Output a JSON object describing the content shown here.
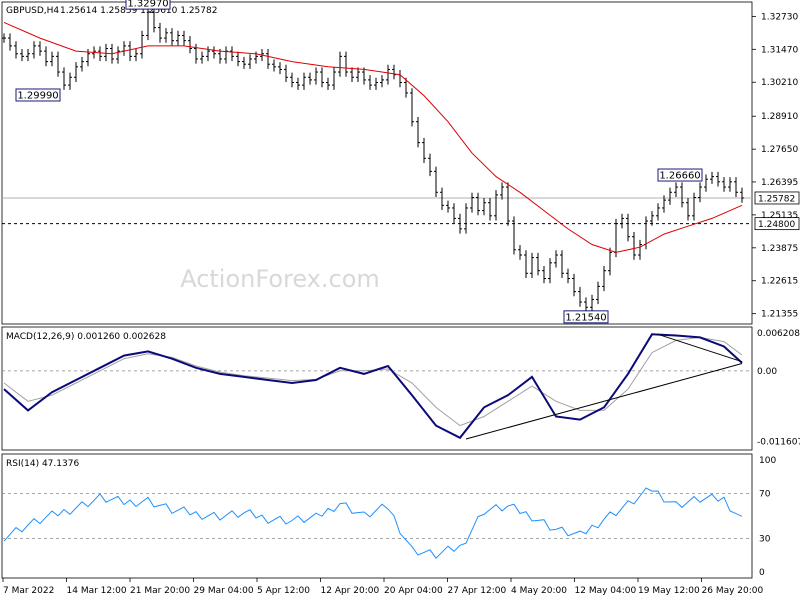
{
  "chart_data": [
    {
      "type": "candlestick",
      "title": "GBPUSD,H4",
      "ohlc_text": "1.25614 1.25859 1.25610 1.25782",
      "watermark": "ActionForex.com",
      "ylim": [
        1.2096,
        1.3328
      ],
      "y_ticks": [
        "1.32730",
        "1.31470",
        "1.30210",
        "1.28910",
        "1.27650",
        "1.26395",
        "1.25135",
        "1.23875",
        "1.22615",
        "1.21355"
      ],
      "current_price": "1.25782",
      "horizontal_level": "1.24800",
      "annotations": [
        {
          "label": "1.32970",
          "x": 24,
          "price": 1.3297
        },
        {
          "label": "1.29990",
          "x": 10,
          "price": 1.2999
        },
        {
          "label": "1.21540",
          "x": 97,
          "price": 1.2154
        },
        {
          "label": "1.26660",
          "x": 117,
          "price": 1.2666
        }
      ],
      "price_points": [
        [
          0,
          1.319
        ],
        [
          1,
          1.316
        ],
        [
          2,
          1.313
        ],
        [
          3,
          1.312
        ],
        [
          4,
          1.313
        ],
        [
          5,
          1.316
        ],
        [
          6,
          1.314
        ],
        [
          7,
          1.31
        ],
        [
          8,
          1.312
        ],
        [
          9,
          1.306
        ],
        [
          10,
          1.301
        ],
        [
          11,
          1.304
        ],
        [
          12,
          1.308
        ],
        [
          13,
          1.31
        ],
        [
          14,
          1.313
        ],
        [
          15,
          1.314
        ],
        [
          16,
          1.312
        ],
        [
          17,
          1.315
        ],
        [
          18,
          1.311
        ],
        [
          19,
          1.314
        ],
        [
          20,
          1.316
        ],
        [
          21,
          1.312
        ],
        [
          22,
          1.313
        ],
        [
          23,
          1.32
        ],
        [
          24,
          1.329
        ],
        [
          25,
          1.323
        ],
        [
          26,
          1.319
        ],
        [
          27,
          1.321
        ],
        [
          28,
          1.318
        ],
        [
          29,
          1.32
        ],
        [
          30,
          1.318
        ],
        [
          31,
          1.315
        ],
        [
          32,
          1.311
        ],
        [
          33,
          1.312
        ],
        [
          34,
          1.314
        ],
        [
          35,
          1.313
        ],
        [
          36,
          1.311
        ],
        [
          37,
          1.314
        ],
        [
          38,
          1.312
        ],
        [
          39,
          1.31
        ],
        [
          40,
          1.309
        ],
        [
          41,
          1.311
        ],
        [
          42,
          1.312
        ],
        [
          43,
          1.313
        ],
        [
          44,
          1.309
        ],
        [
          45,
          1.308
        ],
        [
          46,
          1.307
        ],
        [
          47,
          1.304
        ],
        [
          48,
          1.302
        ],
        [
          49,
          1.301
        ],
        [
          50,
          1.304
        ],
        [
          51,
          1.303
        ],
        [
          52,
          1.306
        ],
        [
          53,
          1.302
        ],
        [
          54,
          1.301
        ],
        [
          55,
          1.306
        ],
        [
          56,
          1.312
        ],
        [
          57,
          1.306
        ],
        [
          58,
          1.304
        ],
        [
          59,
          1.306
        ],
        [
          60,
          1.303
        ],
        [
          61,
          1.301
        ],
        [
          62,
          1.302
        ],
        [
          63,
          1.303
        ],
        [
          64,
          1.307
        ],
        [
          65,
          1.305
        ],
        [
          66,
          1.302
        ],
        [
          67,
          1.298
        ],
        [
          68,
          1.287
        ],
        [
          69,
          1.279
        ],
        [
          70,
          1.273
        ],
        [
          71,
          1.268
        ],
        [
          72,
          1.26
        ],
        [
          73,
          1.255
        ],
        [
          74,
          1.254
        ],
        [
          75,
          1.25
        ],
        [
          76,
          1.246
        ],
        [
          77,
          1.254
        ],
        [
          78,
          1.258
        ],
        [
          79,
          1.253
        ],
        [
          80,
          1.256
        ],
        [
          81,
          1.251
        ],
        [
          82,
          1.259
        ],
        [
          83,
          1.262
        ],
        [
          84,
          1.249
        ],
        [
          85,
          1.238
        ],
        [
          86,
          1.236
        ],
        [
          87,
          1.229
        ],
        [
          88,
          1.235
        ],
        [
          89,
          1.23
        ],
        [
          90,
          1.227
        ],
        [
          91,
          1.233
        ],
        [
          92,
          1.236
        ],
        [
          93,
          1.229
        ],
        [
          94,
          1.227
        ],
        [
          95,
          1.222
        ],
        [
          96,
          1.218
        ],
        [
          97,
          1.216
        ],
        [
          98,
          1.219
        ],
        [
          99,
          1.224
        ],
        [
          100,
          1.23
        ],
        [
          101,
          1.237
        ],
        [
          102,
          1.248
        ],
        [
          103,
          1.25
        ],
        [
          104,
          1.243
        ],
        [
          105,
          1.236
        ],
        [
          106,
          1.24
        ],
        [
          107,
          1.249
        ],
        [
          108,
          1.251
        ],
        [
          109,
          1.254
        ],
        [
          110,
          1.257
        ],
        [
          111,
          1.26
        ],
        [
          112,
          1.262
        ],
        [
          113,
          1.256
        ],
        [
          114,
          1.251
        ],
        [
          115,
          1.258
        ],
        [
          116,
          1.262
        ],
        [
          117,
          1.265
        ],
        [
          118,
          1.266
        ],
        [
          119,
          1.264
        ],
        [
          120,
          1.262
        ],
        [
          121,
          1.264
        ],
        [
          122,
          1.26
        ],
        [
          123,
          1.2578
        ]
      ],
      "moving_average_points": [
        [
          0,
          1.325
        ],
        [
          6,
          1.319
        ],
        [
          12,
          1.314
        ],
        [
          18,
          1.313
        ],
        [
          24,
          1.316
        ],
        [
          30,
          1.316
        ],
        [
          36,
          1.314
        ],
        [
          42,
          1.313
        ],
        [
          48,
          1.31
        ],
        [
          54,
          1.308
        ],
        [
          60,
          1.307
        ],
        [
          66,
          1.305
        ],
        [
          70,
          1.297
        ],
        [
          74,
          1.287
        ],
        [
          78,
          1.275
        ],
        [
          82,
          1.266
        ],
        [
          86,
          1.26
        ],
        [
          90,
          1.253
        ],
        [
          94,
          1.246
        ],
        [
          98,
          1.24
        ],
        [
          102,
          1.237
        ],
        [
          106,
          1.239
        ],
        [
          110,
          1.244
        ],
        [
          114,
          1.247
        ],
        [
          118,
          1.25
        ],
        [
          123,
          1.255
        ]
      ]
    },
    {
      "type": "line",
      "title": "MACD(12,26,9) 0.001260 0.002628",
      "ylim": [
        -0.013,
        0.0072
      ],
      "y_ticks": [
        "0.006208",
        "0.00",
        "-0.011607"
      ],
      "series": [
        {
          "values": [
            [
              0,
              -0.003
            ],
            [
              4,
              -0.0065
            ],
            [
              8,
              -0.0035
            ],
            [
              12,
              -0.0015
            ],
            [
              16,
              0.0005
            ],
            [
              20,
              0.0025
            ],
            [
              24,
              0.0032
            ],
            [
              28,
              0.002
            ],
            [
              32,
              0.0005
            ],
            [
              36,
              -0.0005
            ],
            [
              40,
              -0.001
            ],
            [
              44,
              -0.0015
            ],
            [
              48,
              -0.002
            ],
            [
              52,
              -0.0015
            ],
            [
              56,
              0.0005
            ],
            [
              60,
              -0.0005
            ],
            [
              64,
              0.0008
            ],
            [
              68,
              -0.004
            ],
            [
              72,
              -0.009
            ],
            [
              76,
              -0.011
            ],
            [
              80,
              -0.006
            ],
            [
              84,
              -0.004
            ],
            [
              88,
              -0.001
            ],
            [
              92,
              -0.0075
            ],
            [
              96,
              -0.008
            ],
            [
              100,
              -0.006
            ],
            [
              104,
              -0.0005
            ],
            [
              108,
              0.006
            ],
            [
              112,
              0.0058
            ],
            [
              116,
              0.0055
            ],
            [
              120,
              0.004
            ],
            [
              123,
              0.0013
            ]
          ]
        },
        {
          "values": [
            [
              0,
              -0.002
            ],
            [
              4,
              -0.005
            ],
            [
              8,
              -0.004
            ],
            [
              12,
              -0.002
            ],
            [
              16,
              0.0
            ],
            [
              20,
              0.002
            ],
            [
              24,
              0.0028
            ],
            [
              28,
              0.0022
            ],
            [
              32,
              0.0008
            ],
            [
              36,
              -0.0002
            ],
            [
              40,
              -0.0008
            ],
            [
              44,
              -0.0012
            ],
            [
              48,
              -0.0016
            ],
            [
              52,
              -0.0014
            ],
            [
              56,
              0.0
            ],
            [
              60,
              0.0
            ],
            [
              64,
              0.0003
            ],
            [
              68,
              -0.002
            ],
            [
              72,
              -0.006
            ],
            [
              76,
              -0.009
            ],
            [
              80,
              -0.0075
            ],
            [
              84,
              -0.005
            ],
            [
              88,
              -0.0025
            ],
            [
              92,
              -0.005
            ],
            [
              96,
              -0.0065
            ],
            [
              100,
              -0.0065
            ],
            [
              104,
              -0.003
            ],
            [
              108,
              0.003
            ],
            [
              112,
              0.005
            ],
            [
              116,
              0.0055
            ],
            [
              120,
              0.0048
            ],
            [
              123,
              0.0026
            ]
          ]
        }
      ],
      "trendlines": [
        [
          [
            77,
            -0.0112
          ],
          [
            123,
            0.0012
          ]
        ],
        [
          [
            109,
            0.006
          ],
          [
            123,
            0.0015
          ]
        ]
      ]
    },
    {
      "type": "line",
      "title": "RSI(14) 47.1376",
      "ylim": [
        0,
        100
      ],
      "y_ticks": [
        "100",
        "70",
        "30",
        "0"
      ],
      "levels": [
        70,
        30
      ],
      "series": [
        {
          "values": [
            [
              0,
              32
            ],
            [
              4,
              42
            ],
            [
              8,
              50
            ],
            [
              12,
              58
            ],
            [
              16,
              66
            ],
            [
              20,
              62
            ],
            [
              24,
              64
            ],
            [
              28,
              55
            ],
            [
              32,
              52
            ],
            [
              36,
              50
            ],
            [
              40,
              52
            ],
            [
              44,
              48
            ],
            [
              48,
              46
            ],
            [
              52,
              48
            ],
            [
              56,
              62
            ],
            [
              60,
              50
            ],
            [
              64,
              58
            ],
            [
              68,
              20
            ],
            [
              72,
              15
            ],
            [
              76,
              22
            ],
            [
              80,
              55
            ],
            [
              84,
              58
            ],
            [
              88,
              50
            ],
            [
              92,
              38
            ],
            [
              96,
              32
            ],
            [
              100,
              48
            ],
            [
              104,
              60
            ],
            [
              108,
              74
            ],
            [
              112,
              60
            ],
            [
              116,
              65
            ],
            [
              120,
              65
            ],
            [
              123,
              47
            ]
          ]
        }
      ]
    }
  ],
  "x_axis": {
    "labels": [
      "7 Mar 2022",
      "14 Mar 12:00",
      "21 Mar 20:00",
      "29 Mar 04:00",
      "5 Apr 12:00",
      "12 Apr 20:00",
      "20 Apr 04:00",
      "27 Apr 12:00",
      "4 May 20:00",
      "12 May 04:00",
      "19 May 12:00",
      "26 May 20:00"
    ]
  },
  "colors": {
    "price": "#000000",
    "moving_average": "#dd0000",
    "macd": "#0a0a7a",
    "signal": "#a0a0a0",
    "rsi": "#1e90ff",
    "trendline": "#000000",
    "annotation_border": "#1a1a7a"
  }
}
